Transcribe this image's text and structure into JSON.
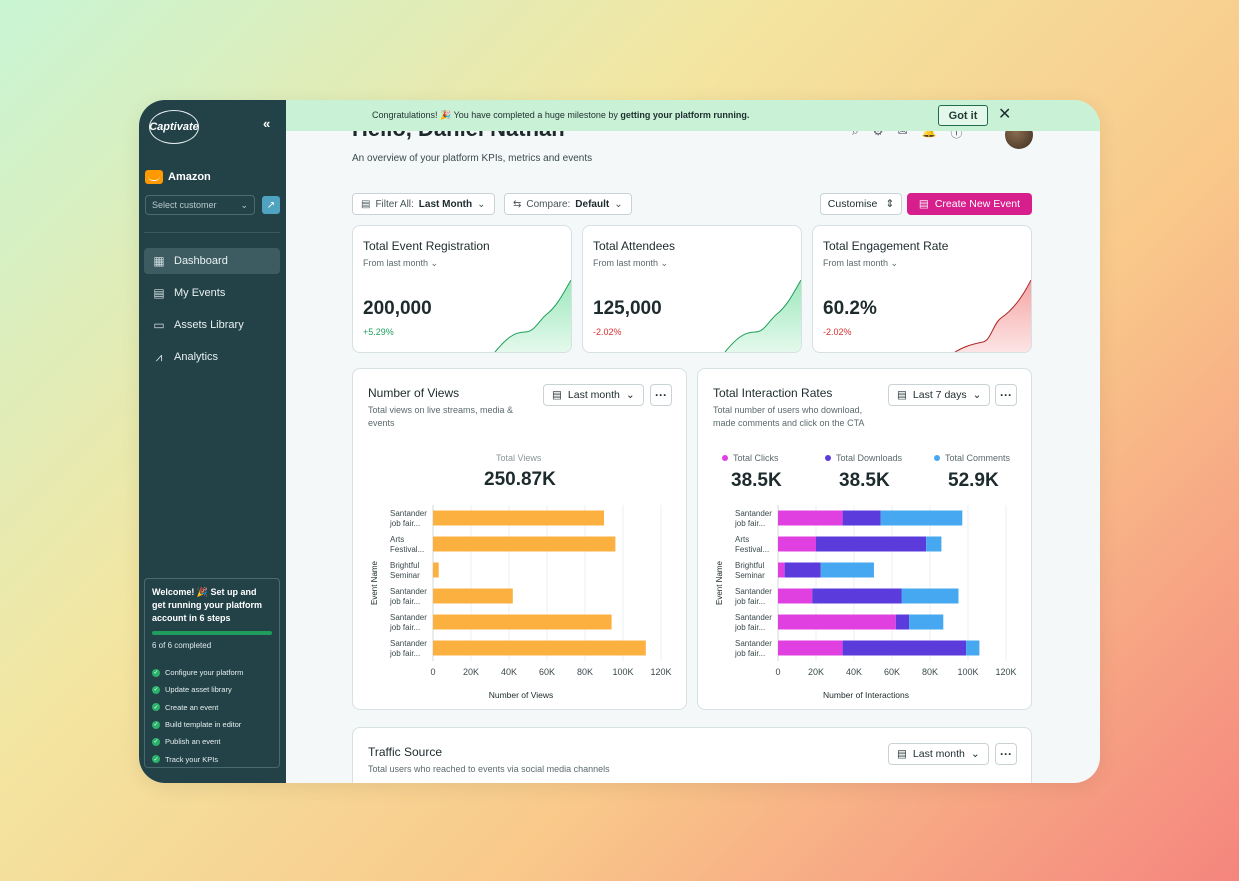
{
  "sidebar": {
    "logo": "Captivate",
    "collapse": "«",
    "company": "Amazon",
    "select_customer": "Select customer",
    "nav": [
      {
        "label": "Dashboard",
        "icon": "dashboard-icon",
        "active": true
      },
      {
        "label": "My Events",
        "icon": "calendar-icon",
        "active": false
      },
      {
        "label": "Assets Library",
        "icon": "folder-icon",
        "active": false
      },
      {
        "label": "Analytics",
        "icon": "analytics-icon",
        "active": false
      }
    ],
    "welcome": {
      "title": "Welcome! 🎉 Set up and get running your platform account in 6 steps",
      "completed": "6 of 6 completed",
      "progress": 1.0,
      "steps": [
        "Configure your platform",
        "Update asset library",
        "Create an event",
        "Build template in editor",
        "Publish an event",
        "Track your KPIs"
      ]
    }
  },
  "banner": {
    "message_prefix": "Congratulations! 🎉 You have completed a huge milestone by ",
    "message_bold": "getting your platform running.",
    "got_it": "Got it",
    "close": "✕"
  },
  "header": {
    "greeting": "Hello, Daniel Nathan",
    "overview": "An overview of your platform KPIs, metrics and events"
  },
  "toolbar": {
    "filter_prefix": "Filter All:",
    "filter_value": "Last Month",
    "compare_prefix": "Compare:",
    "compare_value": "Default",
    "customise": "Customise",
    "create": "Create New Event"
  },
  "kpis": [
    {
      "title": "Total Event Registration",
      "from": "From last month",
      "value": "200,000",
      "change": "+5.29%",
      "trend": "up",
      "color": "#1e9e5a"
    },
    {
      "title": "Total Attendees",
      "from": "From last month",
      "value": "125,000",
      "change": "-2.02%",
      "trend": "up",
      "color": "#d92d2d"
    },
    {
      "title": "Total Engagement Rate",
      "from": "From last month",
      "value": "60.2%",
      "change": "-2.02%",
      "trend": "down",
      "color": "#d92d2d"
    }
  ],
  "views_card": {
    "title": "Number of Views",
    "subtitle_1": "Total views on live streams, media &",
    "subtitle_2": "events",
    "range": "Last month",
    "total_label": "Total Views",
    "total_value": "250.87K"
  },
  "interactions_card": {
    "title": "Total Interaction Rates",
    "subtitle_1": "Total number of users who download,",
    "subtitle_2": "made comments and click on the CTA",
    "range": "Last 7 days",
    "legend": [
      {
        "label": "Total Clicks",
        "value": "38.5K",
        "color": "#e040e0"
      },
      {
        "label": "Total Downloads",
        "value": "38.5K",
        "color": "#5b3bdc"
      },
      {
        "label": "Total Comments",
        "value": "52.9K",
        "color": "#45a8f0"
      }
    ]
  },
  "traffic_card": {
    "title": "Traffic Source",
    "subtitle": "Total users who reached to events via social media channels",
    "range": "Last month"
  },
  "chart_data": [
    {
      "type": "bar",
      "orientation": "horizontal",
      "categories": [
        [
          "Santander",
          "job fair..."
        ],
        [
          "Arts",
          "Festival..."
        ],
        [
          "Brightful",
          "Seminar"
        ],
        [
          "Santander",
          "job fair..."
        ],
        [
          "Santander",
          "job fair..."
        ],
        [
          "Santander",
          "job fair..."
        ]
      ],
      "series": [
        {
          "values": [
            90000,
            96000,
            3000,
            42000,
            94000,
            112000
          ],
          "color": "#fbb040"
        }
      ],
      "xlabel": "Number of Views",
      "ylabel": "Event Name",
      "xlim": [
        0,
        120000
      ],
      "xticks": [
        "0",
        "20K",
        "40K",
        "60K",
        "80K",
        "100K",
        "120K"
      ],
      "grid": true
    },
    {
      "type": "bar",
      "orientation": "horizontal",
      "stacked": true,
      "categories": [
        [
          "Santander",
          "job fair..."
        ],
        [
          "Arts",
          "Festival..."
        ],
        [
          "Brightful",
          "Seminar"
        ],
        [
          "Santander",
          "job fair..."
        ],
        [
          "Santander",
          "job fair..."
        ],
        [
          "Santander",
          "job fair..."
        ]
      ],
      "series": [
        {
          "name": "Total Clicks",
          "values": [
            34000,
            20000,
            3500,
            18000,
            62000,
            34000
          ],
          "color": "#e040e0"
        },
        {
          "name": "Total Downloads",
          "values": [
            20000,
            58000,
            19000,
            47000,
            7000,
            65000
          ],
          "color": "#5b3bdc"
        },
        {
          "name": "Total Comments",
          "values": [
            43000,
            8000,
            28000,
            30000,
            18000,
            7000
          ],
          "color": "#45a8f0"
        }
      ],
      "xlabel": "Number of Interactions",
      "ylabel": "Event Name",
      "xlim": [
        0,
        120000
      ],
      "xticks": [
        "0",
        "20K",
        "40K",
        "60K",
        "80K",
        "100K",
        "120K"
      ],
      "grid": true
    }
  ]
}
